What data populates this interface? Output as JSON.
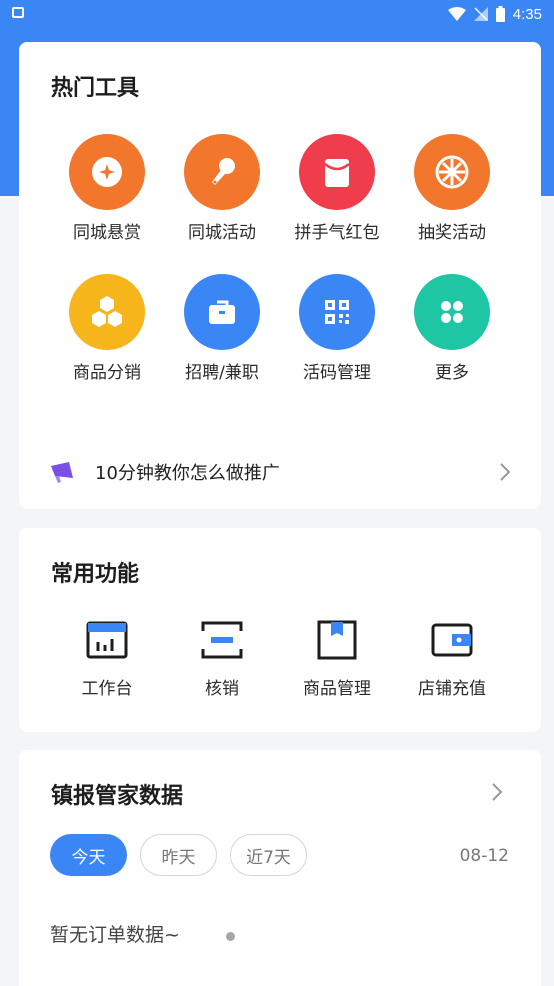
{
  "status_bar": {
    "time": "4:35"
  },
  "hot_tools": {
    "title": "热门工具",
    "items": [
      {
        "label": "同城悬赏",
        "icon": "coin-icon",
        "color": "#f2762b"
      },
      {
        "label": "同城活动",
        "icon": "microphone-icon",
        "color": "#f2762b"
      },
      {
        "label": "拼手气红包",
        "icon": "red-envelope-icon",
        "color": "#ef3d4c"
      },
      {
        "label": "抽奖活动",
        "icon": "lucky-wheel-icon",
        "color": "#f2762b"
      },
      {
        "label": "商品分销",
        "icon": "hexagons-icon",
        "color": "#f7b51c"
      },
      {
        "label": "招聘/兼职",
        "icon": "briefcase-icon",
        "color": "#3a86f4"
      },
      {
        "label": "活码管理",
        "icon": "qrcode-icon",
        "color": "#3a86f4"
      },
      {
        "label": "更多",
        "icon": "clover-icon",
        "color": "#1fc6a4"
      }
    ],
    "promo_text": "10分钟教你怎么做推广"
  },
  "common_functions": {
    "title": "常用功能",
    "items": [
      {
        "label": "工作台",
        "icon": "dashboard-icon"
      },
      {
        "label": "核销",
        "icon": "scan-icon"
      },
      {
        "label": "商品管理",
        "icon": "box-icon"
      },
      {
        "label": "店铺充值",
        "icon": "wallet-icon"
      }
    ]
  },
  "data_section": {
    "title": "镇报管家数据",
    "tabs": [
      {
        "label": "今天",
        "active": true
      },
      {
        "label": "昨天",
        "active": false
      },
      {
        "label": "近7天",
        "active": false
      }
    ],
    "date": "08-12",
    "empty_text": "暂无订单数据~"
  },
  "colors": {
    "primary": "#3a86f4",
    "background": "#f4f5f8"
  }
}
